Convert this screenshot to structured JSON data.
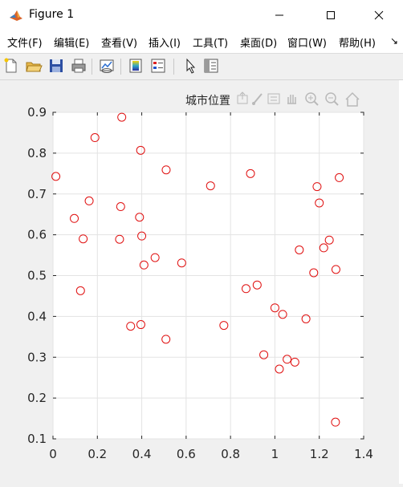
{
  "window": {
    "title": "Figure 1",
    "minimize_icon": "minimize-icon",
    "maximize_icon": "maximize-icon",
    "close_icon": "close-icon"
  },
  "menu": {
    "items": [
      {
        "label": "文件(F)"
      },
      {
        "label": "编辑(E)"
      },
      {
        "label": "查看(V)"
      },
      {
        "label": "插入(I)"
      },
      {
        "label": "工具(T)"
      },
      {
        "label": "桌面(D)"
      },
      {
        "label": "窗口(W)"
      },
      {
        "label": "帮助(H)"
      }
    ],
    "overflow_icon": "chevron-right-icon"
  },
  "toolbar": {
    "buttons": [
      {
        "icon": "new-figure-icon"
      },
      {
        "icon": "open-file-icon"
      },
      {
        "icon": "save-icon"
      },
      {
        "icon": "print-icon"
      },
      {
        "icon": "link-plot-icon"
      },
      {
        "icon": "colorbar-icon"
      },
      {
        "icon": "legend-icon"
      },
      {
        "icon": "pointer-icon"
      },
      {
        "icon": "property-inspector-icon"
      }
    ]
  },
  "axes_toolbar": {
    "icons": [
      "export-icon",
      "brush-icon",
      "data-tips-icon",
      "pan-icon",
      "zoom-in-icon",
      "zoom-out-icon",
      "home-icon"
    ]
  },
  "colors": {
    "marker": "#e01010",
    "grid": "#e3e3e3",
    "axis": "#262626"
  },
  "chart_data": {
    "type": "scatter",
    "title": "城市位置",
    "xlabel": "",
    "ylabel": "",
    "xlim": [
      0,
      1.4
    ],
    "ylim": [
      0.1,
      0.9
    ],
    "xticks": [
      "0",
      "0.2",
      "0.4",
      "0.6",
      "0.8",
      "1",
      "1.2",
      "1.4"
    ],
    "yticks": [
      "0.1",
      "0.2",
      "0.3",
      "0.4",
      "0.5",
      "0.6",
      "0.7",
      "0.8",
      "0.9"
    ],
    "grid": true,
    "marker": "open-circle",
    "x": [
      0.013,
      0.096,
      0.124,
      0.136,
      0.163,
      0.189,
      0.3,
      0.305,
      0.31,
      0.35,
      0.39,
      0.395,
      0.396,
      0.4,
      0.41,
      0.46,
      0.51,
      0.509,
      0.58,
      0.71,
      0.77,
      0.87,
      0.89,
      0.92,
      0.95,
      1.0,
      1.02,
      1.035,
      1.055,
      1.09,
      1.11,
      1.14,
      1.175,
      1.19,
      1.2,
      1.22,
      1.245,
      1.275,
      1.29,
      1.273
    ],
    "y": [
      0.743,
      0.64,
      0.463,
      0.59,
      0.683,
      0.838,
      0.589,
      0.669,
      0.888,
      0.376,
      0.643,
      0.807,
      0.38,
      0.597,
      0.526,
      0.544,
      0.759,
      0.344,
      0.531,
      0.72,
      0.378,
      0.468,
      0.75,
      0.477,
      0.306,
      0.421,
      0.271,
      0.405,
      0.295,
      0.288,
      0.563,
      0.394,
      0.507,
      0.718,
      0.678,
      0.568,
      0.587,
      0.515,
      0.74,
      0.141
    ]
  }
}
